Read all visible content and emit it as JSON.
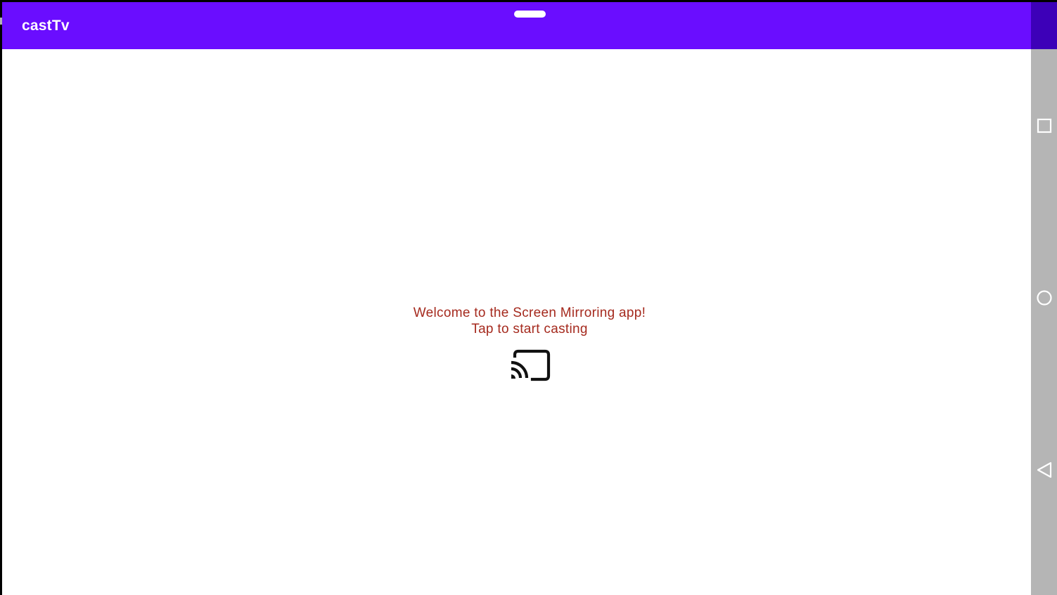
{
  "app_bar": {
    "title": "castTv",
    "color": "#6a0dff",
    "status_color": "#3d00b8"
  },
  "main": {
    "welcome_line1": "Welcome to the Screen Mirroring app!",
    "welcome_line2": "Tap to start casting",
    "text_color": "#a52a1e",
    "cast_icon": "cast-icon"
  },
  "nav_bar": {
    "color": "#b5b5b5",
    "buttons": [
      "recents-icon",
      "home-icon",
      "back-icon"
    ]
  }
}
